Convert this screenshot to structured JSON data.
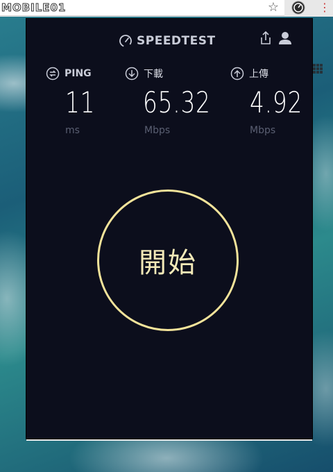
{
  "browser": {
    "site_logo": "MOBILE01",
    "icons": [
      "star-icon",
      "speedtest-extension-icon",
      "menu-icon"
    ]
  },
  "header": {
    "brand": "SPEEDTEST",
    "icons": [
      "speedometer-icon",
      "share-icon",
      "user-icon"
    ]
  },
  "metrics": {
    "ping": {
      "label": "PING",
      "value": "11",
      "unit": "ms"
    },
    "download": {
      "label": "下載",
      "value": "65.32",
      "unit": "Mbps"
    },
    "upload": {
      "label": "上傳",
      "value": "4.92",
      "unit": "Mbps"
    }
  },
  "start": {
    "label": "開始"
  },
  "colors": {
    "panel_bg": "#0c0e1c",
    "accent_ring": "#f3e39a",
    "value_text": "#ffffff",
    "unit_text": "#5a5f72"
  }
}
